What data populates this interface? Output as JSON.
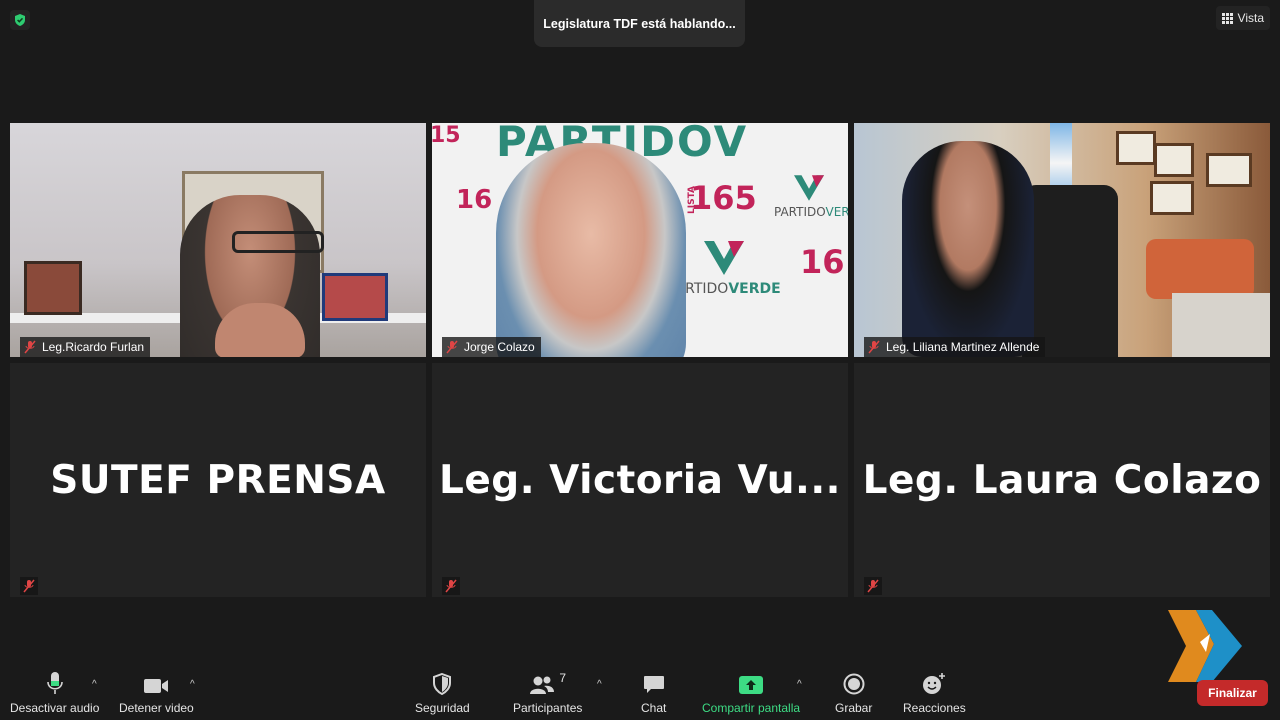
{
  "meeting": {
    "speaking_banner": "Legislatura TDF está hablando...",
    "view_label": "Vista"
  },
  "participants_video": [
    {
      "name": "Leg.Ricardo Furlan",
      "muted": true
    },
    {
      "name": "Jorge Colazo",
      "muted": true
    },
    {
      "name": "Leg. Liliana Martinez Allende",
      "muted": true
    }
  ],
  "participants_novideo": [
    {
      "display_name": "SUTEF PRENSA",
      "muted": true
    },
    {
      "display_name": "Leg. Victoria Vu...",
      "muted": true
    },
    {
      "display_name": "Leg. Laura Colazo",
      "muted": true
    }
  ],
  "video_backdrop": {
    "top_text": "PARTIDOV",
    "brand_prefix": "PARTIDO",
    "brand_suffix": "VERDE",
    "list_word": "LISTA",
    "list_number": "165",
    "list_number_short": "16",
    "left_edge_text": "15"
  },
  "toolbar": {
    "audio_label": "Desactivar audio",
    "video_label": "Detener video",
    "security_label": "Seguridad",
    "participants_label": "Participantes",
    "participants_count": "7",
    "chat_label": "Chat",
    "share_label": "Compartir pantalla",
    "record_label": "Grabar",
    "reactions_label": "Reacciones",
    "end_label": "Finalizar"
  },
  "colors": {
    "background": "#1a1a1a",
    "tile": "#232323",
    "share_green": "#3ddc84",
    "end_red": "#c42a2a",
    "muted_red": "#e04545"
  }
}
